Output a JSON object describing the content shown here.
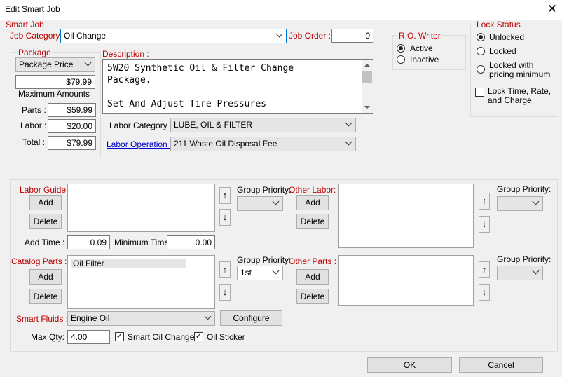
{
  "window": {
    "title": "Edit Smart Job",
    "close_glyph": "✕"
  },
  "smart_job": {
    "group_label": "Smart Job",
    "job_category_label": "Job Category :",
    "job_category_value": "Oil Change",
    "job_order_label": "Job Order :",
    "job_order_value": "0"
  },
  "package": {
    "group_label": "Package",
    "mode_value": "Package Price",
    "price_value": "$79.99",
    "max_amounts_label": "Maximum Amounts",
    "parts_label": "Parts :",
    "parts_value": "$59.99",
    "labor_label": "Labor :",
    "labor_value": "$20.00",
    "total_label": "Total :",
    "total_value": "$79.99"
  },
  "description": {
    "label": "Description :",
    "line1": "5W20 Synthetic Oil & Filter Change",
    "line2": "Package.",
    "line3": "",
    "line4": "Set And Adjust Tire Pressures"
  },
  "labor": {
    "category_label": "Labor Category :",
    "category_value": "LUBE, OIL & FILTER",
    "operation_label": "Labor Operation :",
    "operation_value": "211 Waste Oil Disposal Fee"
  },
  "ro_writer": {
    "group_label": "R.O. Writer",
    "active_label": "Active",
    "inactive_label": "Inactive",
    "selected": "Active"
  },
  "lock_status": {
    "group_label": "Lock Status",
    "unlocked_label": "Unlocked",
    "locked_label": "Locked",
    "locked_min_label_1": "Locked with",
    "locked_min_label_2": "pricing minimum",
    "selected": "Unlocked",
    "lock_time_label_1": "Lock Time, Rate,",
    "lock_time_label_2": "and Charge",
    "lock_time_checked": false
  },
  "labor_guide": {
    "label": "Labor Guide:",
    "add_label": "Add",
    "delete_label": "Delete",
    "group_priority_label": "Group Priority:",
    "group_priority_value": "",
    "add_time_label": "Add Time :",
    "add_time_value": "0.09",
    "min_time_label": "Minimum Time :",
    "min_time_value": "0.00"
  },
  "other_labor": {
    "label": "Other Labor:",
    "add_label": "Add",
    "delete_label": "Delete",
    "group_priority_label": "Group Priority:",
    "group_priority_value": ""
  },
  "catalog_parts": {
    "label": "Catalog Parts :",
    "add_label": "Add",
    "delete_label": "Delete",
    "items": [
      "Oil Filter"
    ],
    "group_priority_label": "Group Priority:",
    "group_priority_value": "1st"
  },
  "other_parts": {
    "label": "Other Parts :",
    "add_label": "Add",
    "delete_label": "Delete",
    "group_priority_label": "Group Priority:",
    "group_priority_value": ""
  },
  "smart_fluids": {
    "label": "Smart Fluids :",
    "value": "Engine Oil",
    "configure_label": "Configure",
    "max_qty_label": "Max Qty:",
    "max_qty_value": "4.00",
    "smart_oil_change_label": "Smart Oil Change",
    "smart_oil_change_checked": true,
    "oil_sticker_label": "Oil Sticker",
    "oil_sticker_checked": true
  },
  "footer": {
    "ok_label": "OK",
    "cancel_label": "Cancel"
  },
  "icons": {
    "up_arrow": "↑",
    "down_arrow": "↓",
    "check": "✓"
  }
}
